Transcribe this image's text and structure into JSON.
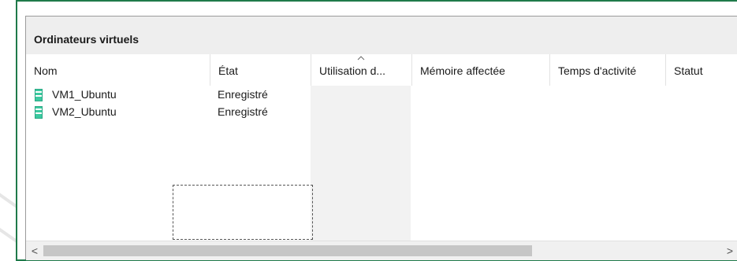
{
  "panel": {
    "title": "Ordinateurs virtuels"
  },
  "columns": [
    {
      "label": "Nom"
    },
    {
      "label": "État"
    },
    {
      "label": "Utilisation d..."
    },
    {
      "label": "Mémoire affectée"
    },
    {
      "label": "Temps d'activité"
    },
    {
      "label": "Statut"
    }
  ],
  "sorted_column_icon": "chevron-up-icon",
  "rows": [
    {
      "icon": "vm-icon",
      "name": "VM1_Ubuntu",
      "state": "Enregistré"
    },
    {
      "icon": "vm-icon",
      "name": "VM2_Ubuntu",
      "state": "Enregistré"
    }
  ],
  "scrollbar": {
    "left_arrow": "<",
    "right_arrow": ">"
  },
  "colors": {
    "frame_border": "#1f7a4a",
    "vm_icon": "#3cc9a0"
  }
}
